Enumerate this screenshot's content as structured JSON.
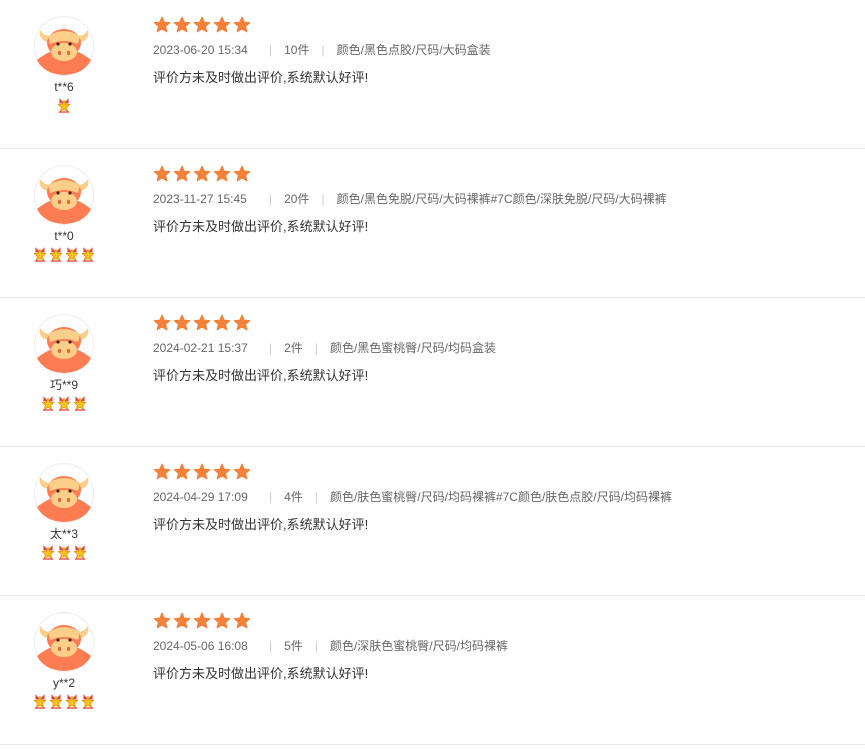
{
  "colors": {
    "rating_star": "#f3813a",
    "avatar_bg": "#fd7c52",
    "avatar_face": "#fbcf8a",
    "divider": "#e8e8e8"
  },
  "reviews": [
    {
      "username": "t**6",
      "level": 1,
      "rating": 5,
      "date": "2023-06-20 15:34",
      "quantity": "10件",
      "spec": "颜色/黑色点胶/尺码/大码盒装",
      "text": "评价方未及时做出评价,系统默认好评!"
    },
    {
      "username": "t**0",
      "level": 4,
      "rating": 5,
      "date": "2023-11-27 15:45",
      "quantity": "20件",
      "spec": "颜色/黑色免脱/尺码/大码裸裤#7C颜色/深肤免脱/尺码/大码裸裤",
      "text": "评价方未及时做出评价,系统默认好评!"
    },
    {
      "username": "巧**9",
      "level": 3,
      "rating": 5,
      "date": "2024-02-21 15:37",
      "quantity": "2件",
      "spec": "颜色/黑色蜜桃臀/尺码/均码盒装",
      "text": "评价方未及时做出评价,系统默认好评!"
    },
    {
      "username": "太**3",
      "level": 3,
      "rating": 5,
      "date": "2024-04-29 17:09",
      "quantity": "4件",
      "spec": "颜色/肤色蜜桃臀/尺码/均码裸裤#7C颜色/肤色点胶/尺码/均码裸裤",
      "text": "评价方未及时做出评价,系统默认好评!"
    },
    {
      "username": "y**2",
      "level": 4,
      "rating": 5,
      "date": "2024-05-06 16:08",
      "quantity": "5件",
      "spec": "颜色/深肤色蜜桃臀/尺码/均码裸裤",
      "text": "评价方未及时做出评价,系统默认好评!"
    }
  ]
}
